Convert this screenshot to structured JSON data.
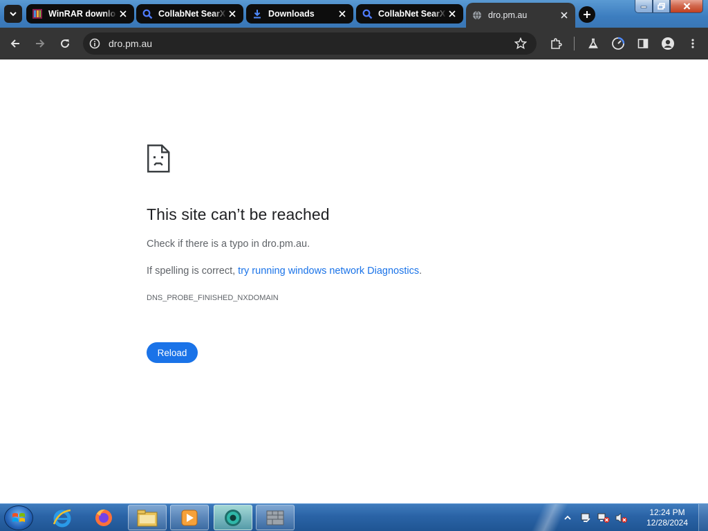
{
  "browser": {
    "tabs": [
      {
        "title": "WinRAR downlo",
        "icon": "winrar-icon",
        "active": false
      },
      {
        "title": "CollabNet SearX",
        "icon": "search-icon",
        "active": false
      },
      {
        "title": "Downloads",
        "icon": "download-icon",
        "active": false
      },
      {
        "title": "CollabNet SearX",
        "icon": "search-icon",
        "active": false
      },
      {
        "title": "dro.pm.au",
        "icon": "globe-icon",
        "active": true
      }
    ],
    "address": "dro.pm.au"
  },
  "error_page": {
    "title": "This site can’t be reached",
    "line1": "Check if there is a typo in dro.pm.au.",
    "line2_prefix": "If spelling is correct, ",
    "line2_link": "try running windows network Diagnostics",
    "line2_suffix": ".",
    "error_code": "DNS_PROBE_FINISHED_NXDOMAIN",
    "reload_label": "Reload"
  },
  "taskbar": {
    "apps": [
      "internet-explorer-icon",
      "firefox-icon",
      "file-explorer-icon",
      "media-player-icon",
      "chrome-icon",
      "firewall-icon"
    ],
    "clock_time": "12:24 PM",
    "clock_date": "12/28/2024"
  },
  "colors": {
    "accent": "#1a73e8",
    "toolbar": "#353535",
    "taskbar": "#2a63a6"
  }
}
